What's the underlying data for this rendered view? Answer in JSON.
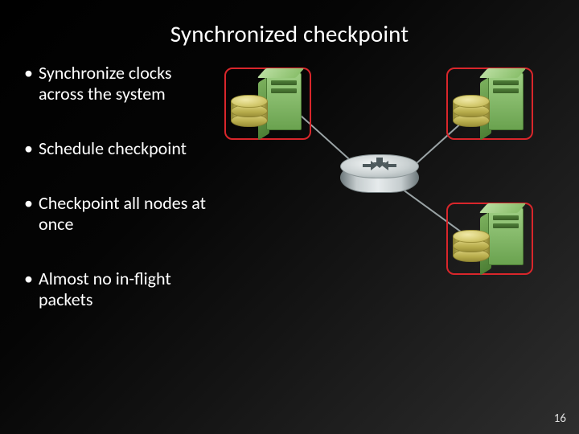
{
  "title": "Synchronized checkpoint",
  "bullets": [
    "Synchronize clocks across the system",
    "Schedule checkpoint",
    "Checkpoint all nodes at once",
    "Almost no in-flight packets"
  ],
  "page_number": "16"
}
